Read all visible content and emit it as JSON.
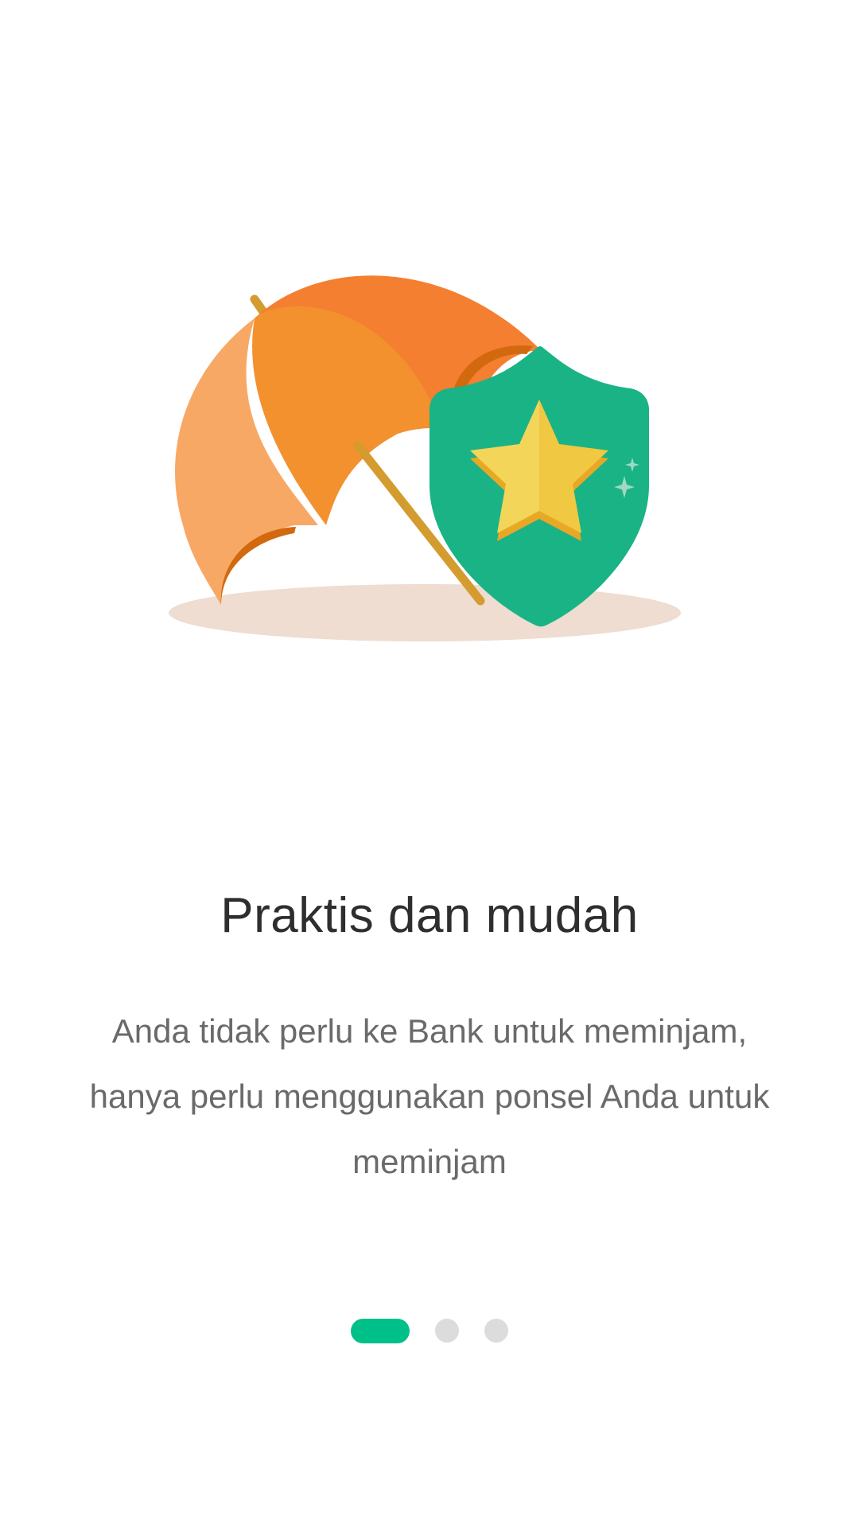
{
  "onboarding": {
    "title": "Praktis dan mudah",
    "description": "Anda tidak perlu ke Bank untuk meminjam, hanya perlu menggunakan ponsel Anda untuk meminjam",
    "illustration": {
      "icons": [
        "umbrella-icon",
        "shield-star-icon",
        "sparkle-icon"
      ],
      "colors": {
        "umbrella_light": "#f8a865",
        "umbrella_mid": "#f2912e",
        "umbrella_dark": "#f47f30",
        "umbrella_inner": "#d2690f",
        "pole": "#d49b2f",
        "shield": "#1ab386",
        "star_light": "#f3d55a",
        "star_dark": "#f0c842",
        "star_shadow": "#e8a826",
        "ground": "#eeddd0"
      }
    },
    "pager": {
      "current_page": 1,
      "total_pages": 3,
      "active_color": "#00c08a",
      "inactive_color": "#dcdcdc"
    }
  }
}
